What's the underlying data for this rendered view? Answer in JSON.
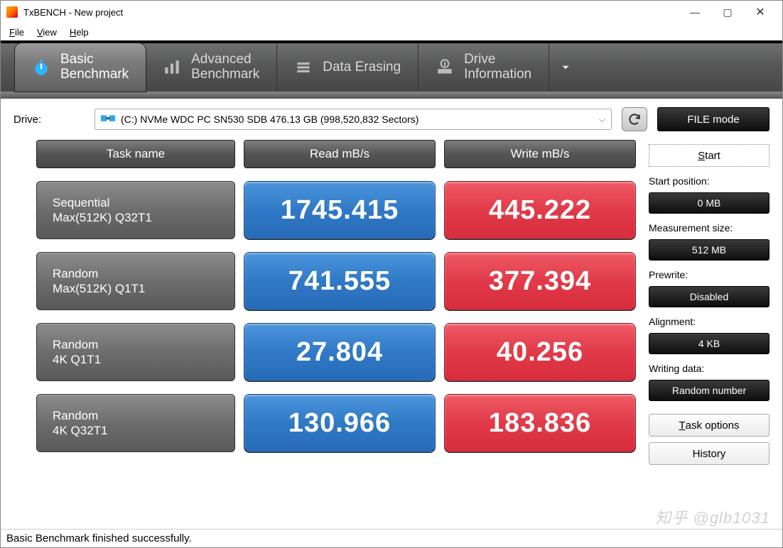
{
  "window": {
    "title": "TxBENCH - New project"
  },
  "menu": {
    "file": "File",
    "view": "View",
    "help": "Help"
  },
  "tabs": {
    "basic": "Basic\nBenchmark",
    "advanced": "Advanced\nBenchmark",
    "erase": "Data Erasing",
    "drive": "Drive\nInformation"
  },
  "drive": {
    "label": "Drive:",
    "selected": "(C:) NVMe WDC PC SN530 SDB  476.13 GB (998,520,832 Sectors)",
    "mode_button": "FILE mode"
  },
  "headers": {
    "task": "Task name",
    "read": "Read mB/s",
    "write": "Write mB/s"
  },
  "rows": [
    {
      "name1": "Sequential",
      "name2": "Max(512K) Q32T1",
      "read": "1745.415",
      "write": "445.222"
    },
    {
      "name1": "Random",
      "name2": "Max(512K) Q1T1",
      "read": "741.555",
      "write": "377.394"
    },
    {
      "name1": "Random",
      "name2": "4K Q1T1",
      "read": "27.804",
      "write": "40.256"
    },
    {
      "name1": "Random",
      "name2": "4K Q32T1",
      "read": "130.966",
      "write": "183.836"
    }
  ],
  "side": {
    "start": "Start",
    "start_pos_label": "Start position:",
    "start_pos_value": "0 MB",
    "meas_label": "Measurement size:",
    "meas_value": "512 MB",
    "prewrite_label": "Prewrite:",
    "prewrite_value": "Disabled",
    "align_label": "Alignment:",
    "align_value": "4 KB",
    "wdata_label": "Writing data:",
    "wdata_value": "Random number",
    "task_options": "Task options",
    "history": "History"
  },
  "status": "Basic Benchmark finished successfully.",
  "watermark": "知乎 @glb1031"
}
